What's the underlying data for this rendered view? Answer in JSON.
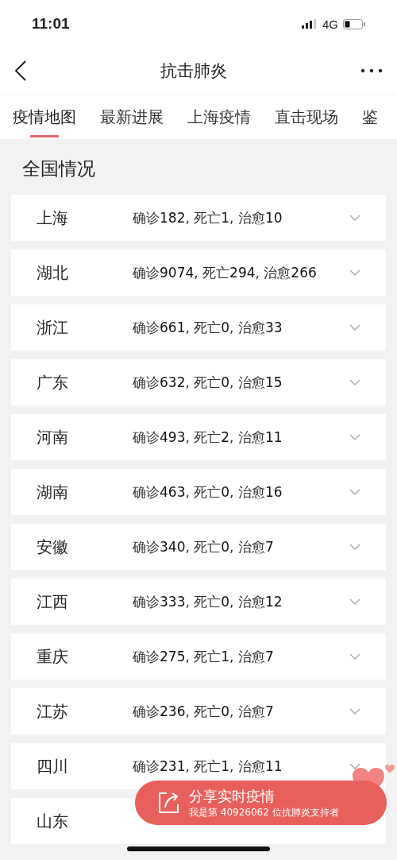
{
  "status_bar": {
    "time": "11:01",
    "network": "4G"
  },
  "nav": {
    "title": "抗击肺炎"
  },
  "tabs": [
    {
      "label": "疫情地图",
      "selected": true
    },
    {
      "label": "最新进展",
      "selected": false
    },
    {
      "label": "上海疫情",
      "selected": false
    },
    {
      "label": "直击现场",
      "selected": false
    },
    {
      "label": "鉴",
      "selected": false
    }
  ],
  "section_title": "全国情况",
  "regions": [
    {
      "name": "上海",
      "stats": "确诊**182**, 死亡**1**, 治愈**10**"
    },
    {
      "name": "湖北",
      "stats": "确诊**9074**, 死亡**294**, 治愈**266**"
    },
    {
      "name": "浙江",
      "stats": "确诊**661**, 死亡**0**, 治愈**33**"
    },
    {
      "name": "广东",
      "stats": "确诊**632**, 死亡**0**, 治愈**15**"
    },
    {
      "name": "河南",
      "stats": "确诊**493**, 死亡**2**, 治愈**11**"
    },
    {
      "name": "湖南",
      "stats": "确诊**463**, 死亡**0**, 治愈**16**"
    },
    {
      "name": "安徽",
      "stats": "确诊**340**, 死亡**0**, 治愈**7**"
    },
    {
      "name": "江西",
      "stats": "确诊**333**, 死亡**0**, 治愈**12**"
    },
    {
      "name": "重庆",
      "stats": "确诊**275**, 死亡**1**, 治愈**7**"
    },
    {
      "name": "江苏",
      "stats": "确诊**236**, 死亡**0**, 治愈**7**"
    },
    {
      "name": "四川",
      "stats": "确诊**231**, 死亡**1**, 治愈**11**"
    },
    {
      "name": "山东"
    }
  ],
  "share_banner": {
    "title": "分享实时疫情",
    "subtitle": "我是第 40926062 位抗肺炎支持者"
  }
}
